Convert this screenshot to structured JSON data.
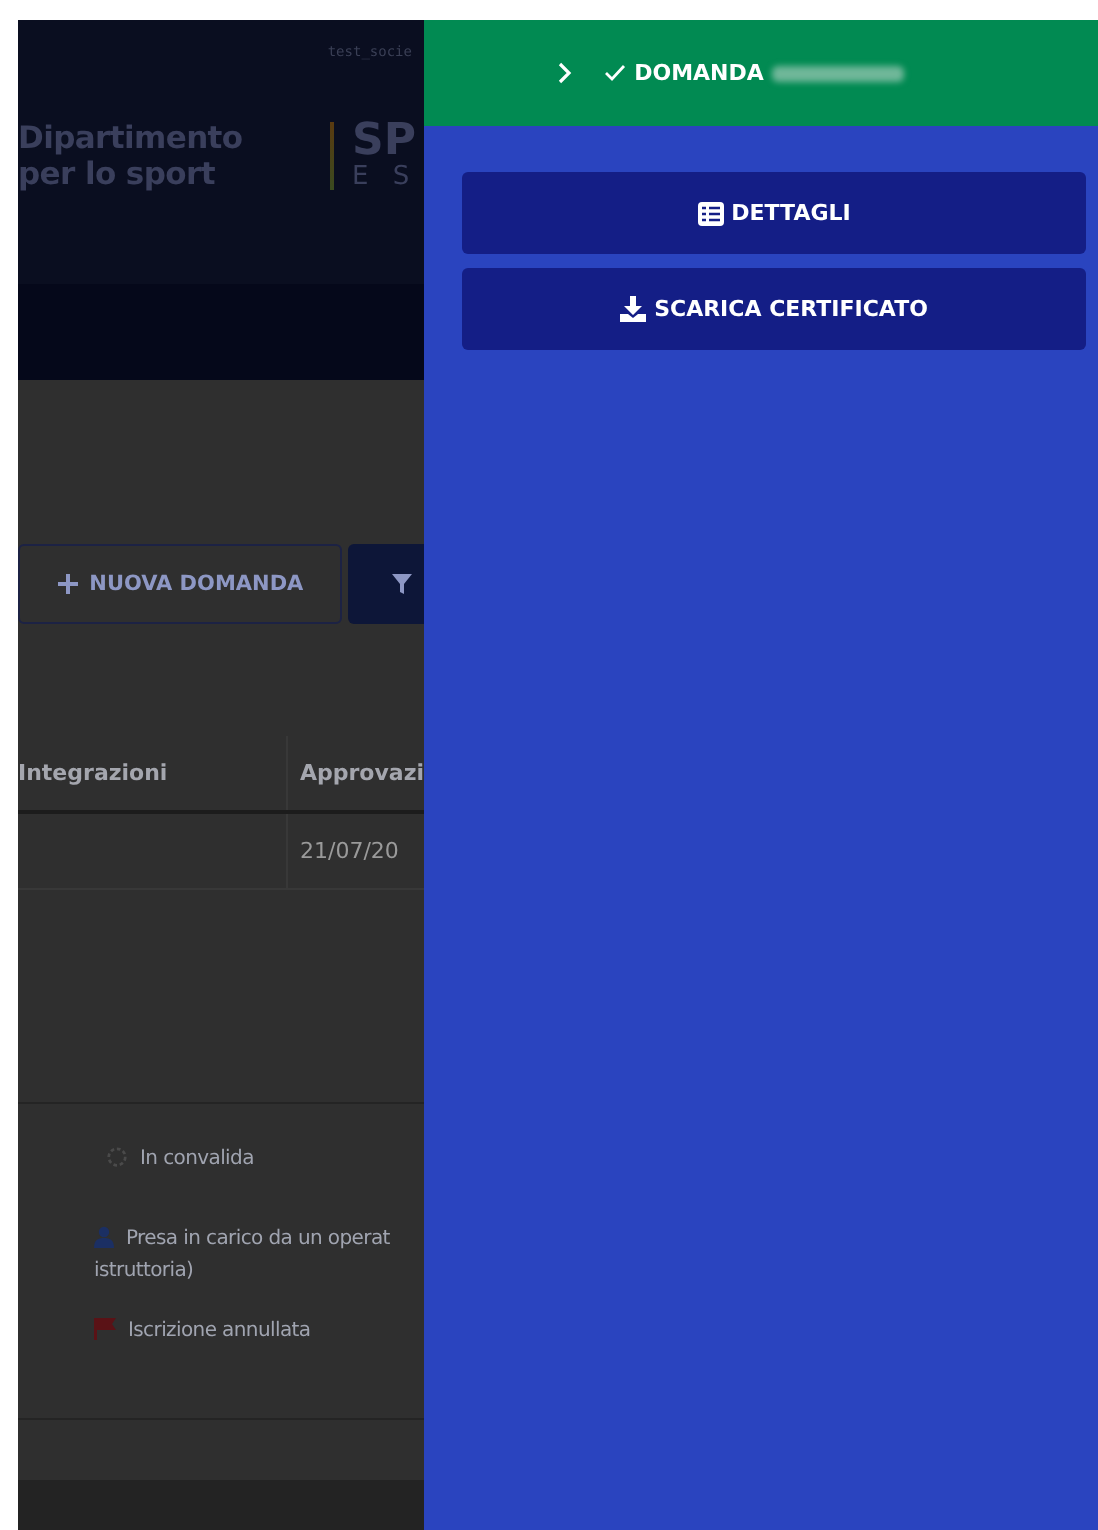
{
  "header": {
    "username": "test_socie",
    "logo_lines": [
      "Dipartimento",
      "per lo sport"
    ],
    "brand_lines": [
      "SP",
      "E S"
    ]
  },
  "actions": [
    {
      "kind": "outline",
      "label": "NUOVA DOMANDA"
    },
    {
      "kind": "filter"
    }
  ],
  "table": {
    "columns": [
      "Integrazioni",
      "Approvazi"
    ],
    "rows": [
      {
        "column_2": "21/07/20"
      }
    ]
  },
  "legend": [
    {
      "kind": "pending",
      "lines": [
        "In convalida"
      ]
    },
    {
      "kind": "assigned",
      "lines": [
        "Presa in carico da un operat",
        "istruttoria)"
      ]
    },
    {
      "kind": "cancelled",
      "lines": [
        "Iscrizione annullata"
      ]
    }
  ],
  "drawer": {
    "title": "DOMANDA",
    "buttons": [
      {
        "kind": "details",
        "label": "DETTAGLI"
      },
      {
        "kind": "download",
        "label": "SCARICA CERTIFICATO"
      }
    ]
  }
}
